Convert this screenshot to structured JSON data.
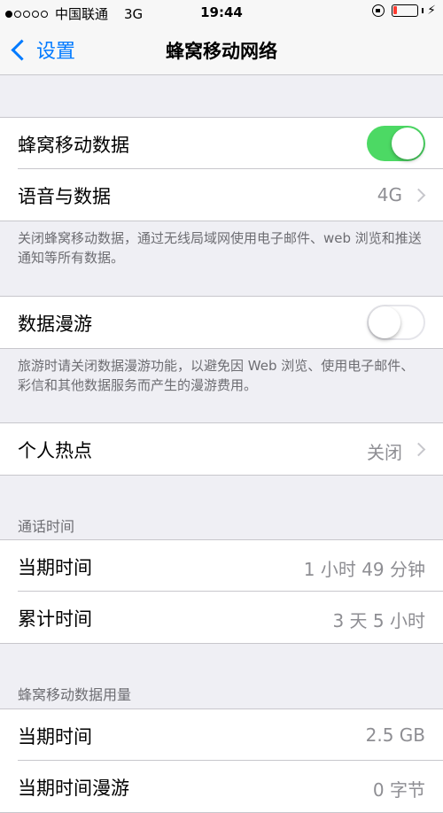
{
  "status_bar": {
    "carrier": "中国联通",
    "network": "3G",
    "time": "19:44",
    "battery_level": 0.15,
    "battery_color": "#ff3b30"
  },
  "nav": {
    "back_label": "设置",
    "title": "蜂窝移动网络"
  },
  "cellular": {
    "data_label": "蜂窝移动数据",
    "data_enabled": true,
    "voice_label": "语音与数据",
    "voice_value": "4G",
    "note": "关闭蜂窝移动数据，通过无线局域网使用电子邮件、web 浏览和推送通知等所有数据。"
  },
  "roaming": {
    "label": "数据漫游",
    "enabled": false,
    "note": "旅游时请关闭数据漫游功能，以避免因 Web 浏览、使用电子邮件、彩信和其他数据服务而产生的漫游费用。"
  },
  "hotspot": {
    "label": "个人热点",
    "value": "关闭"
  },
  "call_time": {
    "header": "通话时间",
    "current_label": "当期时间",
    "current_value": "1 小时 49 分钟",
    "total_label": "累计时间",
    "total_value": "3 天 5 小时"
  },
  "data_usage": {
    "header": "蜂窝移动数据用量",
    "current_label": "当期时间",
    "current_value": "2.5 GB",
    "roaming_label": "当期时间漫游",
    "roaming_value": "0 字节"
  },
  "colors": {
    "accent": "#007aff",
    "toggle_on": "#4cd964"
  }
}
